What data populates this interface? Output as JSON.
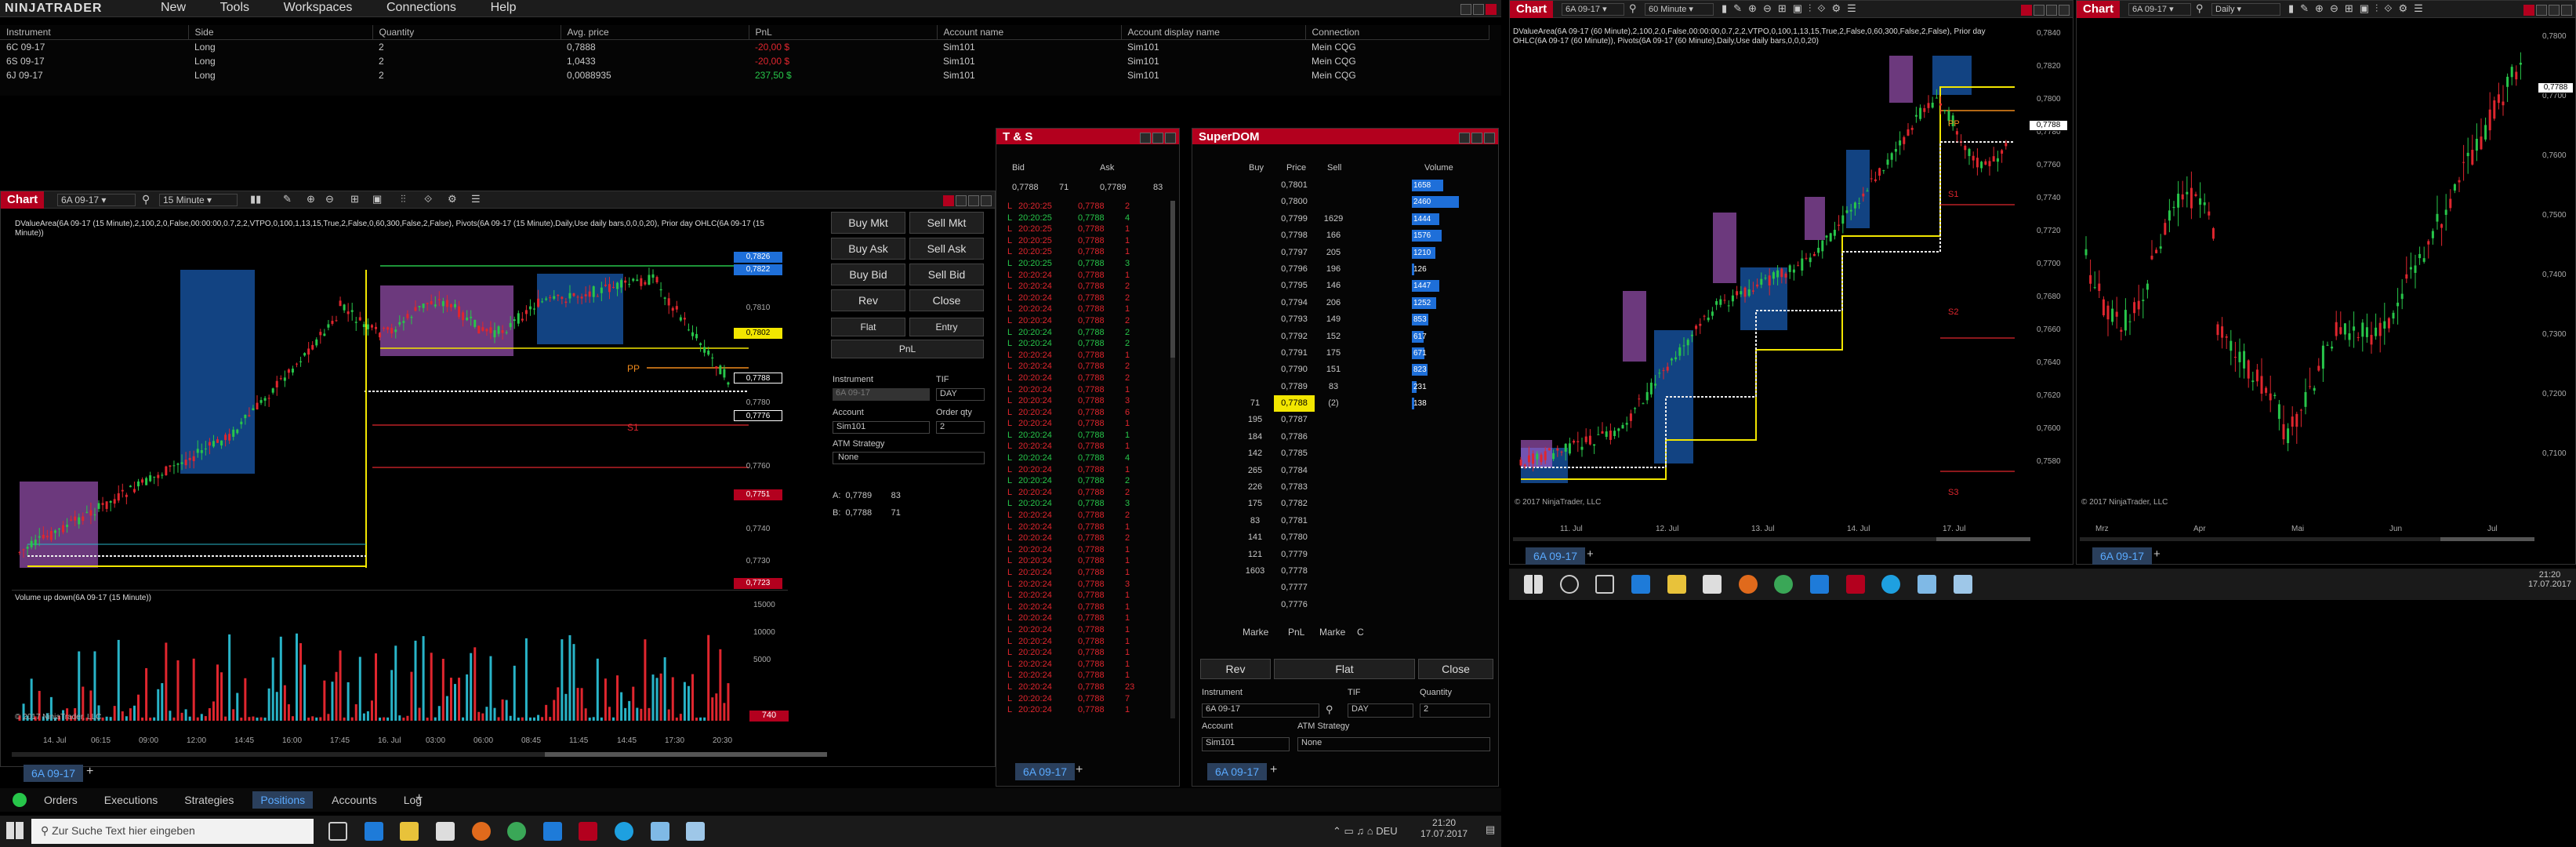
{
  "app": {
    "logo": "NINJATRADER",
    "menu": [
      "New",
      "Tools",
      "Workspaces",
      "Connections",
      "Help"
    ]
  },
  "positions": {
    "headers": [
      "Instrument",
      "Side",
      "Quantity",
      "Avg. price",
      "PnL",
      "Account name",
      "Account display name",
      "Connection"
    ],
    "rows": [
      {
        "instrument": "6C 09-17",
        "side": "Long",
        "quantity": "2",
        "avg": "0,7888",
        "pnl": "-20,00 $",
        "account": "Sim101",
        "display": "Sim101",
        "conn": "Mein CQG",
        "pnl_color": "red"
      },
      {
        "instrument": "6S 09-17",
        "side": "Long",
        "quantity": "2",
        "avg": "1,0433",
        "pnl": "-20,00 $",
        "account": "Sim101",
        "display": "Sim101",
        "conn": "Mein CQG",
        "pnl_color": "red"
      },
      {
        "instrument": "6J 09-17",
        "side": "Long",
        "quantity": "2",
        "avg": "0,0088935",
        "pnl": "237,50 $",
        "account": "Sim101",
        "display": "Sim101",
        "conn": "Mein CQG",
        "pnl_color": "green"
      }
    ]
  },
  "chart1": {
    "title": "Chart",
    "instrument": "6A 09-17",
    "interval": "15 Minute",
    "indicator_text": "DValueArea(6A 09-17 (15 Minute),2,100,2,0,False,00:00:00,0.7,2,2,VTPO,0,100,1,13,15,True,2,False,0,60,300,False,2,False), Pivots(6A 09-17 (15 Minute),Daily,Use daily bars,0,0,0,20), Prior day OHLC(6A 09-17 (15 Minute))",
    "volume_title": "Volume up down(6A 09-17 (15 Minute))",
    "copyright": "© 2017 NinjaTrader, LLC",
    "price_labels": [
      {
        "text": "0,7826",
        "color": "#1e6fd9",
        "level": 0.7826
      },
      {
        "text": "0,7822",
        "color": "#1e6fd9",
        "level": 0.7822
      },
      {
        "text": "0,7810",
        "color": "",
        "level": 0.781
      },
      {
        "text": "0,7802",
        "color": "#f2e600",
        "level": 0.7802
      },
      {
        "text": "0,7788",
        "color": "#000",
        "level": 0.7788
      },
      {
        "text": "0,7780",
        "color": "",
        "level": 0.778
      },
      {
        "text": "0,7776",
        "color": "#000",
        "level": 0.7776
      },
      {
        "text": "0,7760",
        "color": "",
        "level": 0.776
      },
      {
        "text": "0,7751",
        "color": "#b3001e",
        "level": 0.7751
      },
      {
        "text": "0,7740",
        "color": "",
        "level": 0.774
      },
      {
        "text": "0,7730",
        "color": "",
        "level": 0.773
      },
      {
        "text": "0,7723",
        "color": "#b3001e",
        "level": 0.7723
      }
    ],
    "vol_labels": [
      "15000",
      "10000",
      "5000"
    ],
    "vol_last": "740",
    "pivot_labels": {
      "pp": "PP",
      "s1": "S1"
    },
    "x_labels": [
      "14. Jul",
      "06:15",
      "09:00",
      "12:00",
      "14:45",
      "16:00",
      "17:45",
      "16. Jul",
      "03:00",
      "06:00",
      "08:45",
      "11:45",
      "14:45",
      "17:30",
      "20:30"
    ],
    "tab": "6A 09-17"
  },
  "order_entry": {
    "buy_mkt": "Buy Mkt",
    "sell_mkt": "Sell Mkt",
    "buy_ask": "Buy Ask",
    "sell_ask": "Sell Ask",
    "buy_bid": "Buy Bid",
    "sell_bid": "Sell Bid",
    "rev": "Rev",
    "close": "Close",
    "flat": "Flat",
    "entry": "Entry",
    "pnl": "PnL",
    "instrument_label": "Instrument",
    "tif_label": "TIF",
    "instrument": "6A 09-17",
    "tif": "DAY",
    "account_label": "Account",
    "qty_label": "Order qty",
    "account": "Sim101",
    "qty": "2",
    "atm_label": "ATM Strategy",
    "atm": "None",
    "ask_line": "A:  0,7789        83",
    "bid_line": "B:  0,7788        71"
  },
  "ts": {
    "title": "T & S",
    "bid_label": "Bid",
    "ask_label": "Ask",
    "bid": "0,7788",
    "bid_size": "71",
    "ask": "0,7789",
    "ask_size": "83",
    "tab": "6A 09-17",
    "rows": [
      [
        "L",
        "20:20:25",
        "0,7788",
        "2",
        "red"
      ],
      [
        "L",
        "20:20:25",
        "0,7788",
        "4",
        "green"
      ],
      [
        "L",
        "20:20:25",
        "0,7788",
        "1",
        "red"
      ],
      [
        "L",
        "20:20:25",
        "0,7788",
        "1",
        "red"
      ],
      [
        "L",
        "20:20:25",
        "0,7788",
        "1",
        "red"
      ],
      [
        "L",
        "20:20:25",
        "0,7788",
        "3",
        "green"
      ],
      [
        "L",
        "20:20:24",
        "0,7788",
        "1",
        "red"
      ],
      [
        "L",
        "20:20:24",
        "0,7788",
        "2",
        "red"
      ],
      [
        "L",
        "20:20:24",
        "0,7788",
        "2",
        "red"
      ],
      [
        "L",
        "20:20:24",
        "0,7788",
        "1",
        "red"
      ],
      [
        "L",
        "20:20:24",
        "0,7788",
        "2",
        "red"
      ],
      [
        "L",
        "20:20:24",
        "0,7788",
        "2",
        "green"
      ],
      [
        "L",
        "20:20:24",
        "0,7788",
        "2",
        "green"
      ],
      [
        "L",
        "20:20:24",
        "0,7788",
        "1",
        "red"
      ],
      [
        "L",
        "20:20:24",
        "0,7788",
        "2",
        "red"
      ],
      [
        "L",
        "20:20:24",
        "0,7788",
        "2",
        "red"
      ],
      [
        "L",
        "20:20:24",
        "0,7788",
        "1",
        "red"
      ],
      [
        "L",
        "20:20:24",
        "0,7788",
        "3",
        "red"
      ],
      [
        "L",
        "20:20:24",
        "0,7788",
        "6",
        "red"
      ],
      [
        "L",
        "20:20:24",
        "0,7788",
        "1",
        "red"
      ],
      [
        "L",
        "20:20:24",
        "0,7788",
        "1",
        "green"
      ],
      [
        "L",
        "20:20:24",
        "0,7788",
        "1",
        "red"
      ],
      [
        "L",
        "20:20:24",
        "0,7788",
        "4",
        "green"
      ],
      [
        "L",
        "20:20:24",
        "0,7788",
        "1",
        "red"
      ],
      [
        "L",
        "20:20:24",
        "0,7788",
        "2",
        "green"
      ],
      [
        "L",
        "20:20:24",
        "0,7788",
        "2",
        "red"
      ],
      [
        "L",
        "20:20:24",
        "0,7788",
        "3",
        "green"
      ],
      [
        "L",
        "20:20:24",
        "0,7788",
        "2",
        "red"
      ],
      [
        "L",
        "20:20:24",
        "0,7788",
        "1",
        "red"
      ],
      [
        "L",
        "20:20:24",
        "0,7788",
        "2",
        "red"
      ],
      [
        "L",
        "20:20:24",
        "0,7788",
        "1",
        "red"
      ],
      [
        "L",
        "20:20:24",
        "0,7788",
        "1",
        "red"
      ],
      [
        "L",
        "20:20:24",
        "0,7788",
        "1",
        "red"
      ],
      [
        "L",
        "20:20:24",
        "0,7788",
        "3",
        "red"
      ],
      [
        "L",
        "20:20:24",
        "0,7788",
        "1",
        "red"
      ],
      [
        "L",
        "20:20:24",
        "0,7788",
        "1",
        "red"
      ],
      [
        "L",
        "20:20:24",
        "0,7788",
        "1",
        "red"
      ],
      [
        "L",
        "20:20:24",
        "0,7788",
        "1",
        "red"
      ],
      [
        "L",
        "20:20:24",
        "0,7788",
        "1",
        "red"
      ],
      [
        "L",
        "20:20:24",
        "0,7788",
        "1",
        "red"
      ],
      [
        "L",
        "20:20:24",
        "0,7788",
        "1",
        "red"
      ],
      [
        "L",
        "20:20:24",
        "0,7788",
        "1",
        "red"
      ],
      [
        "L",
        "20:20:24",
        "0,7788",
        "23",
        "red"
      ],
      [
        "L",
        "20:20:24",
        "0,7788",
        "7",
        "red"
      ],
      [
        "L",
        "20:20:24",
        "0,7788",
        "1",
        "red"
      ]
    ]
  },
  "dom": {
    "title": "SuperDOM",
    "buy_label": "Buy",
    "price_label": "Price",
    "sell_label": "Sell",
    "volume_label": "Volume",
    "rows": [
      [
        "",
        "0,7801",
        "",
        "1658"
      ],
      [
        "",
        "0,7800",
        "",
        "2460"
      ],
      [
        "",
        "0,7799",
        "1629",
        "1444"
      ],
      [
        "",
        "0,7798",
        "166",
        "1576"
      ],
      [
        "",
        "0,7797",
        "205",
        "1210"
      ],
      [
        "",
        "0,7796",
        "196",
        "126"
      ],
      [
        "",
        "0,7795",
        "146",
        "1447"
      ],
      [
        "",
        "0,7794",
        "206",
        "1252"
      ],
      [
        "",
        "0,7793",
        "149",
        "853"
      ],
      [
        "",
        "0,7792",
        "152",
        "617"
      ],
      [
        "",
        "0,7791",
        "175",
        "671"
      ],
      [
        "",
        "0,7790",
        "151",
        "823"
      ],
      [
        "",
        "0,7789",
        "83",
        "231"
      ],
      [
        "71",
        "0,7788",
        "(2)",
        "138"
      ],
      [
        "195",
        "0,7787",
        "",
        ""
      ],
      [
        "184",
        "0,7786",
        "",
        ""
      ],
      [
        "142",
        "0,7785",
        "",
        ""
      ],
      [
        "265",
        "0,7784",
        "",
        ""
      ],
      [
        "226",
        "0,7783",
        "",
        ""
      ],
      [
        "175",
        "0,7782",
        "",
        ""
      ],
      [
        "83",
        "0,7781",
        "",
        ""
      ],
      [
        "141",
        "0,7780",
        "",
        ""
      ],
      [
        "121",
        "0,7779",
        "",
        ""
      ],
      [
        "1603",
        "0,7778",
        "",
        ""
      ],
      [
        "",
        "0,7777",
        "",
        ""
      ],
      [
        "",
        "0,7776",
        "",
        ""
      ]
    ],
    "marker_left": "Marke",
    "pnl": "PnL",
    "marker_right": "Marke",
    "c": "C",
    "rev": "Rev",
    "flat": "Flat",
    "close": "Close",
    "instrument_label": "Instrument",
    "tif_label": "TIF",
    "qty_label": "Quantity",
    "instrument": "6A 09-17",
    "tif": "DAY",
    "qty": "2",
    "account_label": "Account",
    "atm_label": "ATM Strategy",
    "account": "Sim101",
    "atm": "None",
    "tab": "6A 09-17"
  },
  "chart2": {
    "title": "Chart",
    "instrument": "6A 09-17",
    "interval": "60 Minute",
    "indicator_text": "DValueArea(6A 09-17 (60 Minute),2,100,2,0,False,00:00:00,0.7,2,2,VTPO,0,100,1,13,15,True,2,False,0,60,300,False,2,False), Prior day OHLC(6A 09-17 (60 Minute)), Pivots(6A 09-17 (60 Minute),Daily,Use daily bars,0,0,0,20)",
    "y_labels": [
      "0,7840",
      "0,7820",
      "0,7800",
      "0,7780",
      "0,7760",
      "0,7740",
      "0,7720",
      "0,7700",
      "0,7680",
      "0,7660",
      "0,7640",
      "0,7620",
      "0,7600",
      "0,7580"
    ],
    "last": "0,7788",
    "x_labels": [
      "11. Jul",
      "12. Jul",
      "13. Jul",
      "14. Jul",
      "17. Jul"
    ],
    "pivot_labels": {
      "pp": "PP",
      "s1": "S1",
      "s2": "S2",
      "s3": "S3"
    },
    "copyright": "© 2017 NinjaTrader, LLC",
    "tab": "6A 09-17"
  },
  "chart3": {
    "title": "Chart",
    "instrument": "6A 09-17",
    "interval": "Daily",
    "y_labels": [
      "0,7800",
      "0,7700",
      "0,7600",
      "0,7500",
      "0,7400",
      "0,7300",
      "0,7200",
      "0,7100"
    ],
    "last": "0,7788",
    "x_labels": [
      "Mrz",
      "Apr",
      "Mai",
      "Jun",
      "Jul"
    ],
    "copyright": "© 2017 NinjaTrader, LLC",
    "tab": "6A 09-17"
  },
  "control_center": {
    "tabs": [
      "Orders",
      "Executions",
      "Strategies",
      "Positions",
      "Accounts",
      "Log"
    ],
    "active": "Positions"
  },
  "taskbar": {
    "search": "Zur Suche Text hier eingeben",
    "time": "21:20",
    "date": "17.07.2017"
  },
  "colors": {
    "accent_red": "#b3001e",
    "up": "#27c64a",
    "down": "#e0262e",
    "value_area_blue": "#1e6fd9",
    "profile_magenta": "#b45fd0",
    "tab_blue": "#2a3f5c"
  }
}
